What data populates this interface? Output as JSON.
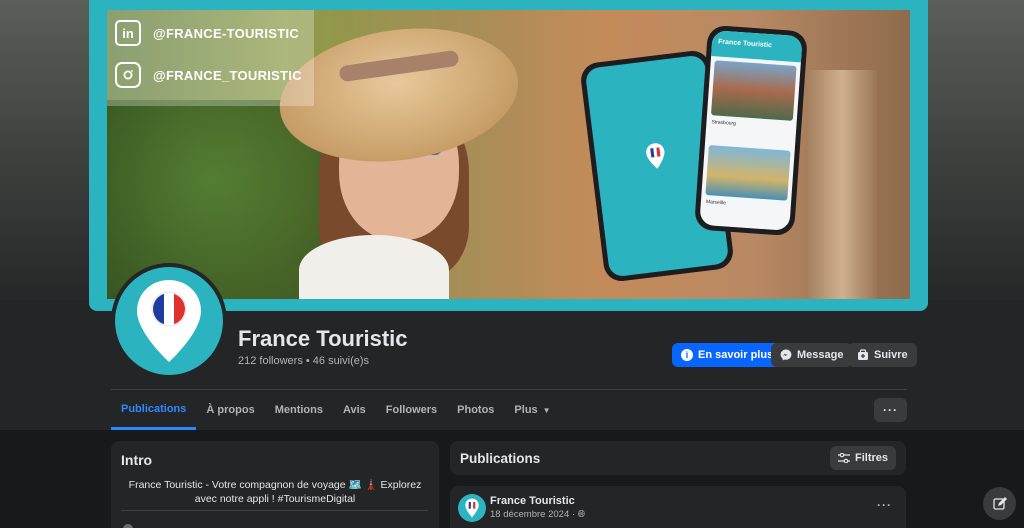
{
  "cover": {
    "linkedin_handle": "@FRANCE-TOURISTIC",
    "instagram_handle": "@FRANCE_TOURISTIC",
    "app_brand": "France Touristic",
    "app_card1_label": "Strasbourg",
    "app_card2_label": "Marseille",
    "accent_color": "#2bb3bf"
  },
  "profile": {
    "name": "France Touristic",
    "followers": "212 followers • 46 suivi(e)s"
  },
  "actions": {
    "learn_more": "En savoir plus",
    "message": "Message",
    "follow": "Suivre"
  },
  "tabs": [
    {
      "label": "Publications",
      "active": true
    },
    {
      "label": "À propos"
    },
    {
      "label": "Mentions"
    },
    {
      "label": "Avis"
    },
    {
      "label": "Followers"
    },
    {
      "label": "Photos"
    },
    {
      "label": "Plus"
    }
  ],
  "intro": {
    "title": "Intro",
    "text": "France Touristic - Votre compagnon de voyage 🗺️ 🗼 Explorez avec notre appli ! #TourismeDigital"
  },
  "publications": {
    "title": "Publications",
    "filter_label": "Filtres"
  },
  "post": {
    "author": "France Touristic",
    "date": "18 décembre 2024 ·"
  },
  "icons": {
    "linkedin": "linkedin-icon",
    "instagram": "instagram-icon",
    "info": "info-icon",
    "messenger": "messenger-icon",
    "follow": "follow-icon",
    "filter": "filter-icon",
    "globe": "globe-icon",
    "edit": "compose-icon"
  },
  "colors": {
    "primary": "#0866ff",
    "active_tab": "#2d88ff",
    "background": "#18191a",
    "card": "#242526"
  }
}
